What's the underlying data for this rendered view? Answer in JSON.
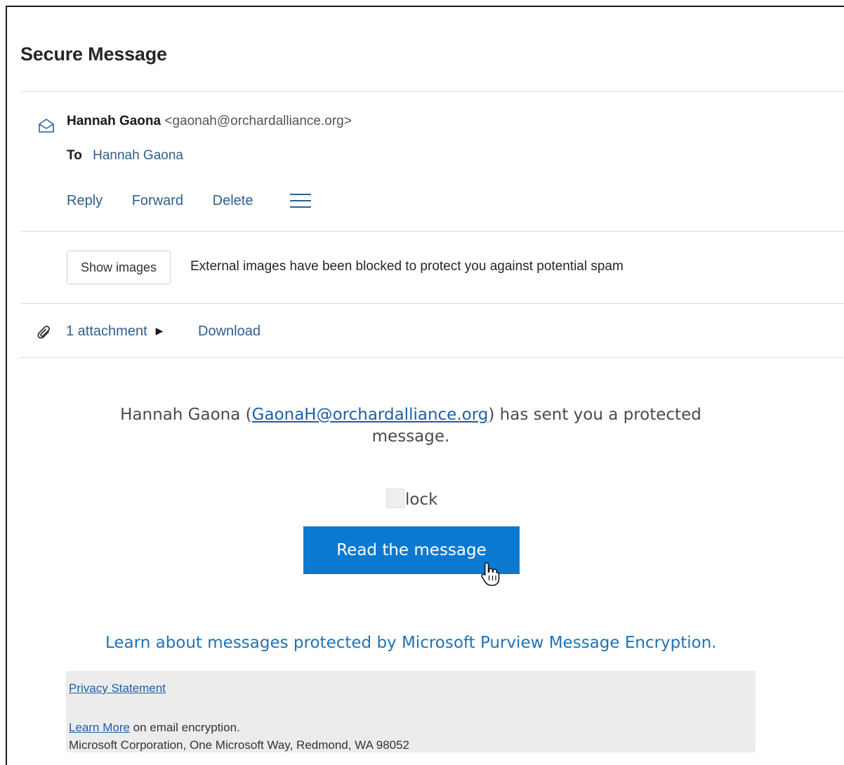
{
  "header": {
    "title": "Secure Message"
  },
  "message": {
    "sender_name": "Hannah Gaona",
    "sender_email": "<gaonah@orchardalliance.org>",
    "to_label": "To",
    "to_name": "Hannah Gaona"
  },
  "actions": {
    "reply": "Reply",
    "forward": "Forward",
    "delete": "Delete"
  },
  "images_bar": {
    "button_label": "Show images",
    "notice": "External images have been blocked to protect you against potential spam"
  },
  "attachments": {
    "label": "1 attachment",
    "download": "Download"
  },
  "body": {
    "notice_prefix": "Hannah Gaona (",
    "notice_link": "GaonaH@orchardalliance.org",
    "notice_suffix": ") has sent you a protected message.",
    "lock_alt": "lock",
    "read_button": "Read the message",
    "learn_link": "Learn about messages protected by Microsoft Purview Message Encryption."
  },
  "footer": {
    "privacy": "Privacy Statement",
    "learn_more": "Learn More",
    "learn_more_suffix": " on email encryption.",
    "address": "Microsoft Corporation, One Microsoft Way, Redmond, WA 98052"
  },
  "icons": {
    "envelope": "envelope-open-icon",
    "menu": "hamburger-menu-icon",
    "attachment": "paperclip-icon",
    "expand": "caret-right-icon",
    "cursor": "hand-pointer-icon"
  },
  "colors": {
    "accent": "#0b79d0",
    "link": "#2f5f8f",
    "footer_bg": "#ececec"
  }
}
